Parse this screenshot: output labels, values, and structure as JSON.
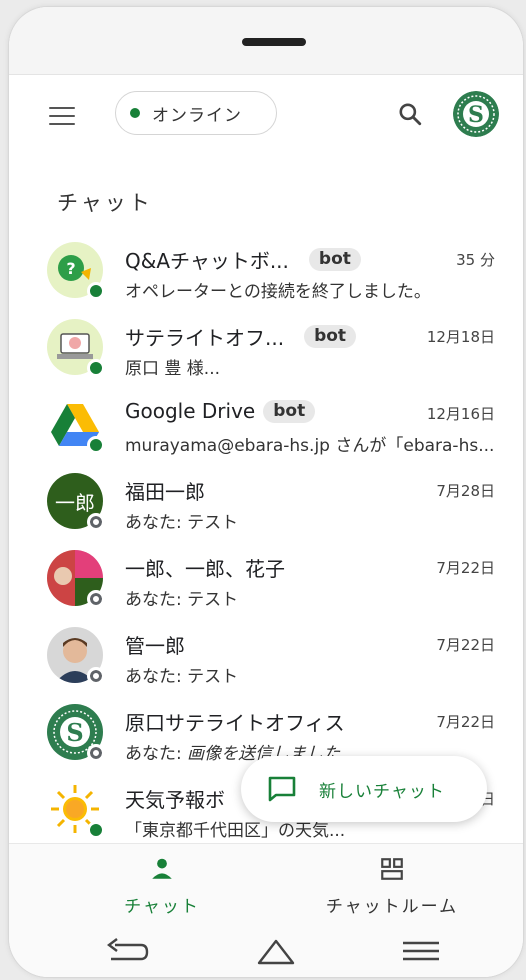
{
  "header": {
    "status_label": "オンライン",
    "status_color": "#188038"
  },
  "section_title": "チャット",
  "chats": [
    {
      "name": "Q&Aチャットボ...",
      "badge": "bot",
      "time": "35 分",
      "preview": "オペレーターとの接続を終了しました。",
      "presence": "online"
    },
    {
      "name": "サテライトオフ...",
      "badge": "bot",
      "time": "12月18日",
      "preview": "原口 豊 様...",
      "presence": "online"
    },
    {
      "name": "Google Drive",
      "badge": "bot",
      "time": "12月16日",
      "preview": "murayama@ebara-hs.jp さんが「ebara-hs...",
      "presence": "online"
    },
    {
      "name": "福田一郎",
      "time": "7月28日",
      "preview": "あなた: テスト",
      "presence": "offline",
      "avatar_text": "一郎"
    },
    {
      "name": "一郎、一郎、花子",
      "time": "7月22日",
      "preview": "あなた: テスト",
      "presence": "offline"
    },
    {
      "name": "管一郎",
      "time": "7月22日",
      "preview": "あなた: テスト",
      "presence": "offline"
    },
    {
      "name": "原口サテライトオフィス",
      "time": "7月22日",
      "preview_prefix": "あなた: ",
      "preview_italic": "画像を送信しました",
      "presence": "offline"
    },
    {
      "name": "天気予報ボ",
      "time": "日",
      "preview": "「東京都千代田区」の天気...",
      "presence": "online"
    }
  ],
  "fab": {
    "label": "新しいチャット"
  },
  "bottom_nav": {
    "chat_label": "チャット",
    "rooms_label": "チャットルーム",
    "active_color": "#188038"
  }
}
